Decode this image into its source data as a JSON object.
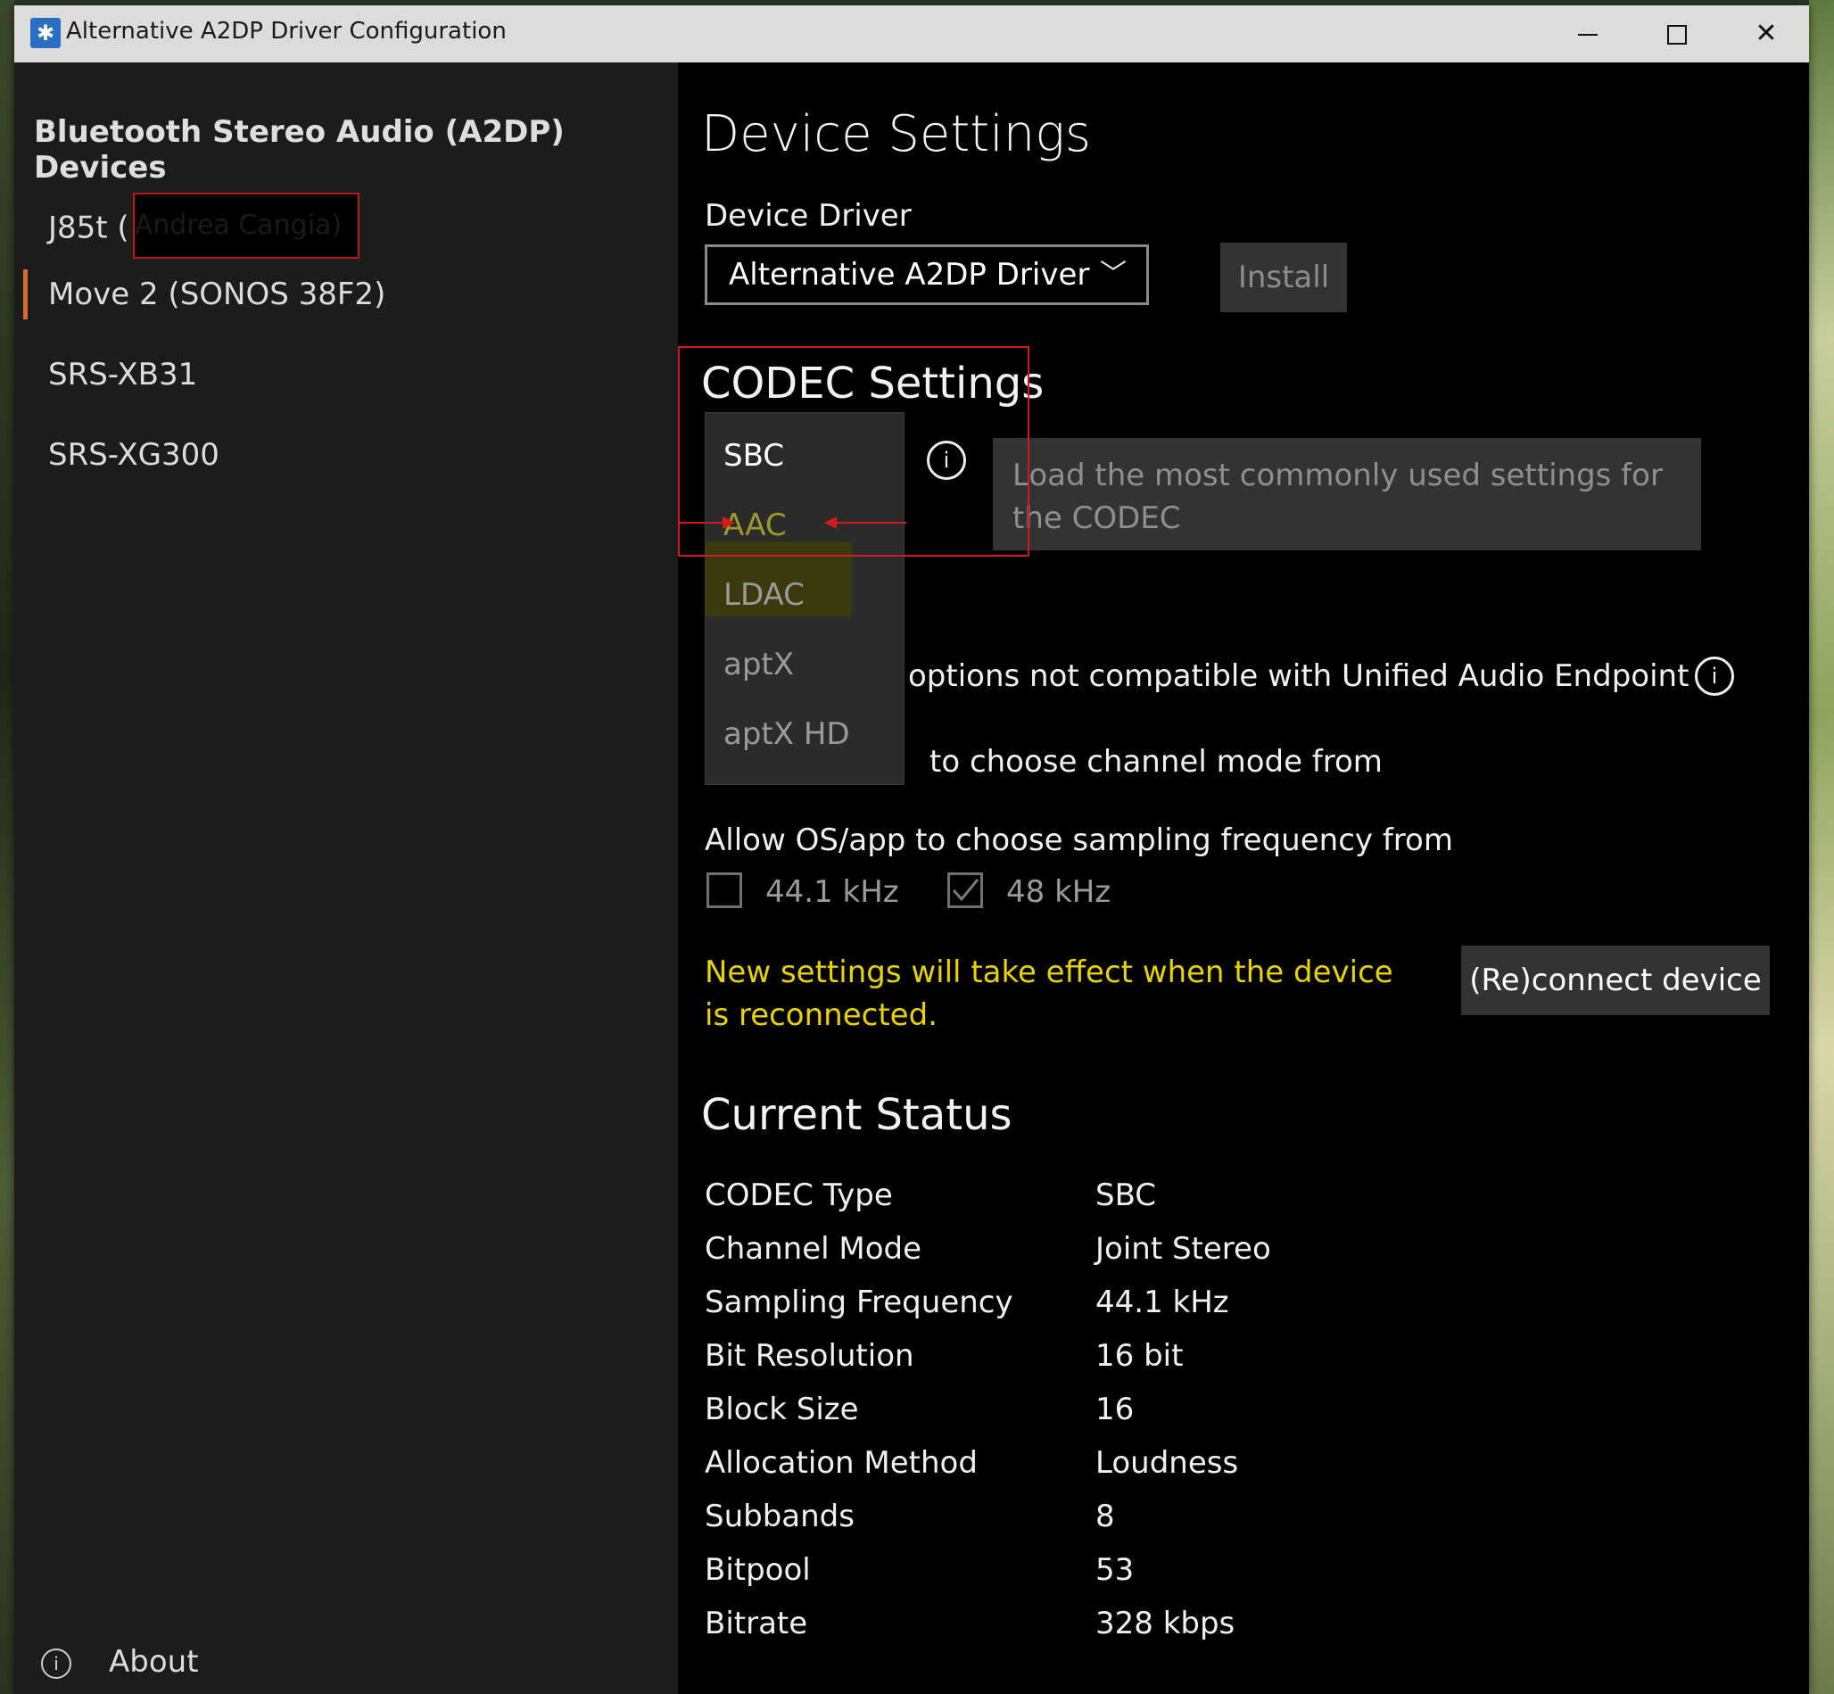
{
  "window": {
    "title": "Alternative A2DP Driver Configuration",
    "minimize_glyph": "",
    "maximize_glyph": "",
    "close_glyph": "✕",
    "app_icon_glyph": "✱"
  },
  "sidebar": {
    "heading": "Bluetooth Stereo Audio (A2DP) Devices",
    "items": [
      {
        "label": "J85t (",
        "redacted_text": "Andrea Cangia)"
      },
      {
        "label": "Move 2 (SONOS 38F2)"
      },
      {
        "label": "SRS-XB31"
      },
      {
        "label": "SRS-XG300"
      }
    ],
    "about": {
      "label": "About",
      "icon": "info-icon",
      "icon_glyph": "i"
    }
  },
  "main": {
    "title": "Device Settings",
    "device_driver": {
      "label": "Device Driver",
      "selected": "Alternative A2DP Driver",
      "chevron": "﹀",
      "install_label": "Install"
    },
    "codec": {
      "title": "CODEC Settings",
      "info_glyph": "i",
      "options": [
        "SBC",
        "AAC",
        "LDAC",
        "aptX",
        "aptX HD"
      ],
      "selected": "SBC",
      "hovered": "AAC",
      "load_defaults_label": "Load the most commonly used settings for the CODEC",
      "partial_option_text": "options not compatible with Unified Audio Endpoint",
      "channel_mode_text": "to choose channel mode from"
    },
    "sampling": {
      "label": "Allow OS/app to choose sampling frequency from",
      "options": [
        {
          "label": "44.1 kHz",
          "checked": false
        },
        {
          "label": "48 kHz",
          "checked": true
        }
      ]
    },
    "notice": "New settings will take effect when the device is reconnected.",
    "reconnect_label": "(Re)connect device",
    "status": {
      "title": "Current Status",
      "rows": [
        {
          "label": "CODEC Type",
          "value": "SBC"
        },
        {
          "label": "Channel Mode",
          "value": "Joint Stereo"
        },
        {
          "label": "Sampling Frequency",
          "value": "44.1 kHz"
        },
        {
          "label": "Bit Resolution",
          "value": "16 bit"
        },
        {
          "label": "Block Size",
          "value": "16"
        },
        {
          "label": "Allocation Method",
          "value": "Loudness"
        },
        {
          "label": "Subbands",
          "value": "8"
        },
        {
          "label": "Bitpool",
          "value": "53"
        },
        {
          "label": "Bitrate",
          "value": "328 kbps"
        }
      ]
    }
  },
  "colors": {
    "accent": "#d96b2b",
    "notice": "#e8d200",
    "annotation_red": "#d41b1b"
  }
}
